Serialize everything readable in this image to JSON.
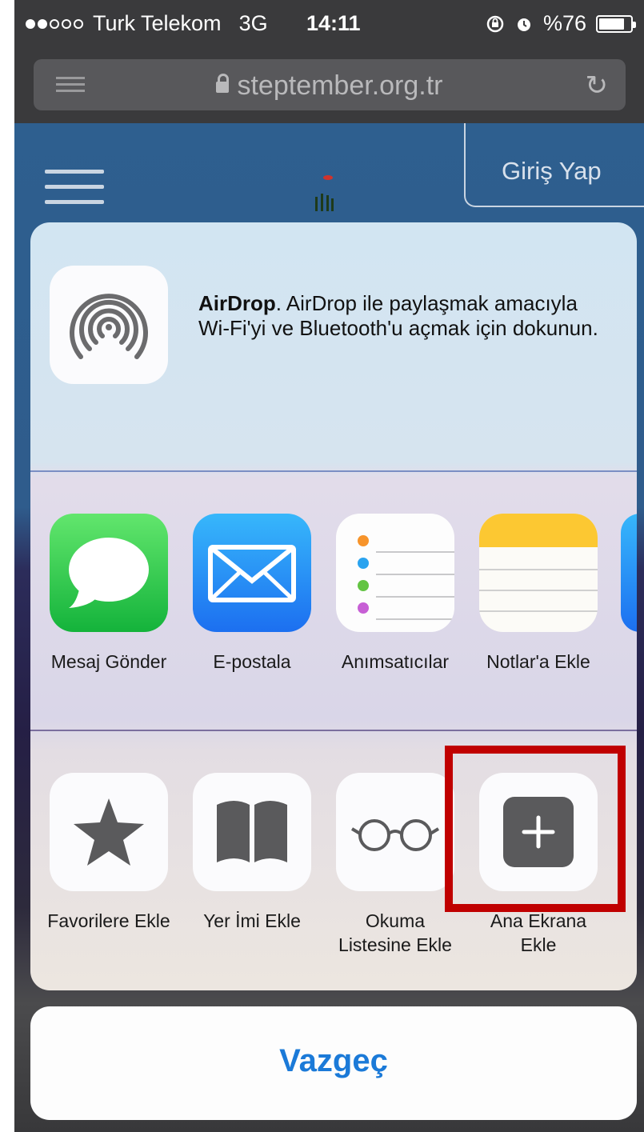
{
  "status_bar": {
    "carrier": "Turk Telekom",
    "network": "3G",
    "time": "14:11",
    "battery": "%76",
    "battery_level": 0.76,
    "signal_bars": 2
  },
  "address_bar": {
    "url": "steptember.org.tr"
  },
  "website": {
    "login_button": "Giriş Yap"
  },
  "share_sheet": {
    "airdrop": {
      "title": "AirDrop",
      "text": ". AirDrop ile paylaşmak amacıyla Wi-Fi'yi ve Bluetooth'u açmak için dokunun."
    },
    "apps": [
      {
        "label": "Mesaj Gönder",
        "icon": "messages-icon"
      },
      {
        "label": "E-postala",
        "icon": "mail-icon"
      },
      {
        "label": "Anımsatıcılar",
        "icon": "reminders-icon"
      },
      {
        "label": "Notlar'a Ekle",
        "icon": "notes-icon"
      }
    ],
    "actions": [
      {
        "label": "Favorilere Ekle",
        "icon": "star-icon"
      },
      {
        "label": "Yer İmi Ekle",
        "icon": "bookmark-icon"
      },
      {
        "label": "Okuma Listesine Ekle",
        "icon": "glasses-icon"
      },
      {
        "label": "Ana Ekrana Ekle",
        "icon": "add-to-home-icon"
      }
    ],
    "cancel_label": "Vazgeç"
  },
  "colors": {
    "accent": "#1b7ad8",
    "highlight": "#c00000"
  }
}
